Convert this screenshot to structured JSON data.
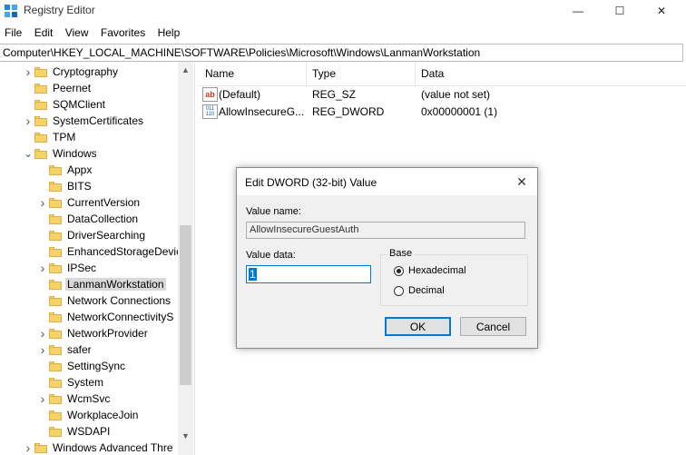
{
  "window": {
    "title": "Registry Editor",
    "minimize_glyph": "—",
    "maximize_glyph": "☐",
    "close_glyph": "✕"
  },
  "menu": [
    "File",
    "Edit",
    "View",
    "Favorites",
    "Help"
  ],
  "address": "Computer\\HKEY_LOCAL_MACHINE\\SOFTWARE\\Policies\\Microsoft\\Windows\\LanmanWorkstation",
  "tree": [
    {
      "label": "Cryptography",
      "level": 1,
      "expander": "closed"
    },
    {
      "label": "Peernet",
      "level": 1,
      "expander": "none"
    },
    {
      "label": "SQMClient",
      "level": 1,
      "expander": "none"
    },
    {
      "label": "SystemCertificates",
      "level": 1,
      "expander": "closed"
    },
    {
      "label": "TPM",
      "level": 1,
      "expander": "none"
    },
    {
      "label": "Windows",
      "level": 1,
      "expander": "open"
    },
    {
      "label": "Appx",
      "level": 2,
      "expander": "none"
    },
    {
      "label": "BITS",
      "level": 2,
      "expander": "none"
    },
    {
      "label": "CurrentVersion",
      "level": 2,
      "expander": "closed"
    },
    {
      "label": "DataCollection",
      "level": 2,
      "expander": "none"
    },
    {
      "label": "DriverSearching",
      "level": 2,
      "expander": "none"
    },
    {
      "label": "EnhancedStorageDevic",
      "level": 2,
      "expander": "none"
    },
    {
      "label": "IPSec",
      "level": 2,
      "expander": "closed"
    },
    {
      "label": "LanmanWorkstation",
      "level": 2,
      "expander": "none",
      "selected": true
    },
    {
      "label": "Network Connections",
      "level": 2,
      "expander": "none"
    },
    {
      "label": "NetworkConnectivityS",
      "level": 2,
      "expander": "none"
    },
    {
      "label": "NetworkProvider",
      "level": 2,
      "expander": "closed"
    },
    {
      "label": "safer",
      "level": 2,
      "expander": "closed"
    },
    {
      "label": "SettingSync",
      "level": 2,
      "expander": "none"
    },
    {
      "label": "System",
      "level": 2,
      "expander": "none"
    },
    {
      "label": "WcmSvc",
      "level": 2,
      "expander": "closed"
    },
    {
      "label": "WorkplaceJoin",
      "level": 2,
      "expander": "none"
    },
    {
      "label": "WSDAPI",
      "level": 2,
      "expander": "none"
    },
    {
      "label": "Windows Advanced Thre",
      "level": 1,
      "expander": "closed"
    }
  ],
  "list": {
    "headers": {
      "name": "Name",
      "type": "Type",
      "data": "Data"
    },
    "rows": [
      {
        "icon": "string-value-icon",
        "icon_text": "ab",
        "name": "(Default)",
        "type": "REG_SZ",
        "data": "(value not set)"
      },
      {
        "icon": "binary-value-icon",
        "icon_text": "011\n110",
        "name": "AllowInsecureG...",
        "type": "REG_DWORD",
        "data": "0x00000001 (1)"
      }
    ]
  },
  "dialog": {
    "title": "Edit DWORD (32-bit) Value",
    "value_name_label": "Value name:",
    "value_name": "AllowInsecureGuestAuth",
    "value_data_label": "Value data:",
    "value_data": "1",
    "base_label": "Base",
    "base_options": [
      {
        "label": "Hexadecimal",
        "checked": true
      },
      {
        "label": "Decimal",
        "checked": false
      }
    ],
    "ok_label": "OK",
    "cancel_label": "Cancel",
    "close_glyph": "✕"
  },
  "colors": {
    "accent": "#0078d7",
    "folder": "#f6d26b"
  }
}
